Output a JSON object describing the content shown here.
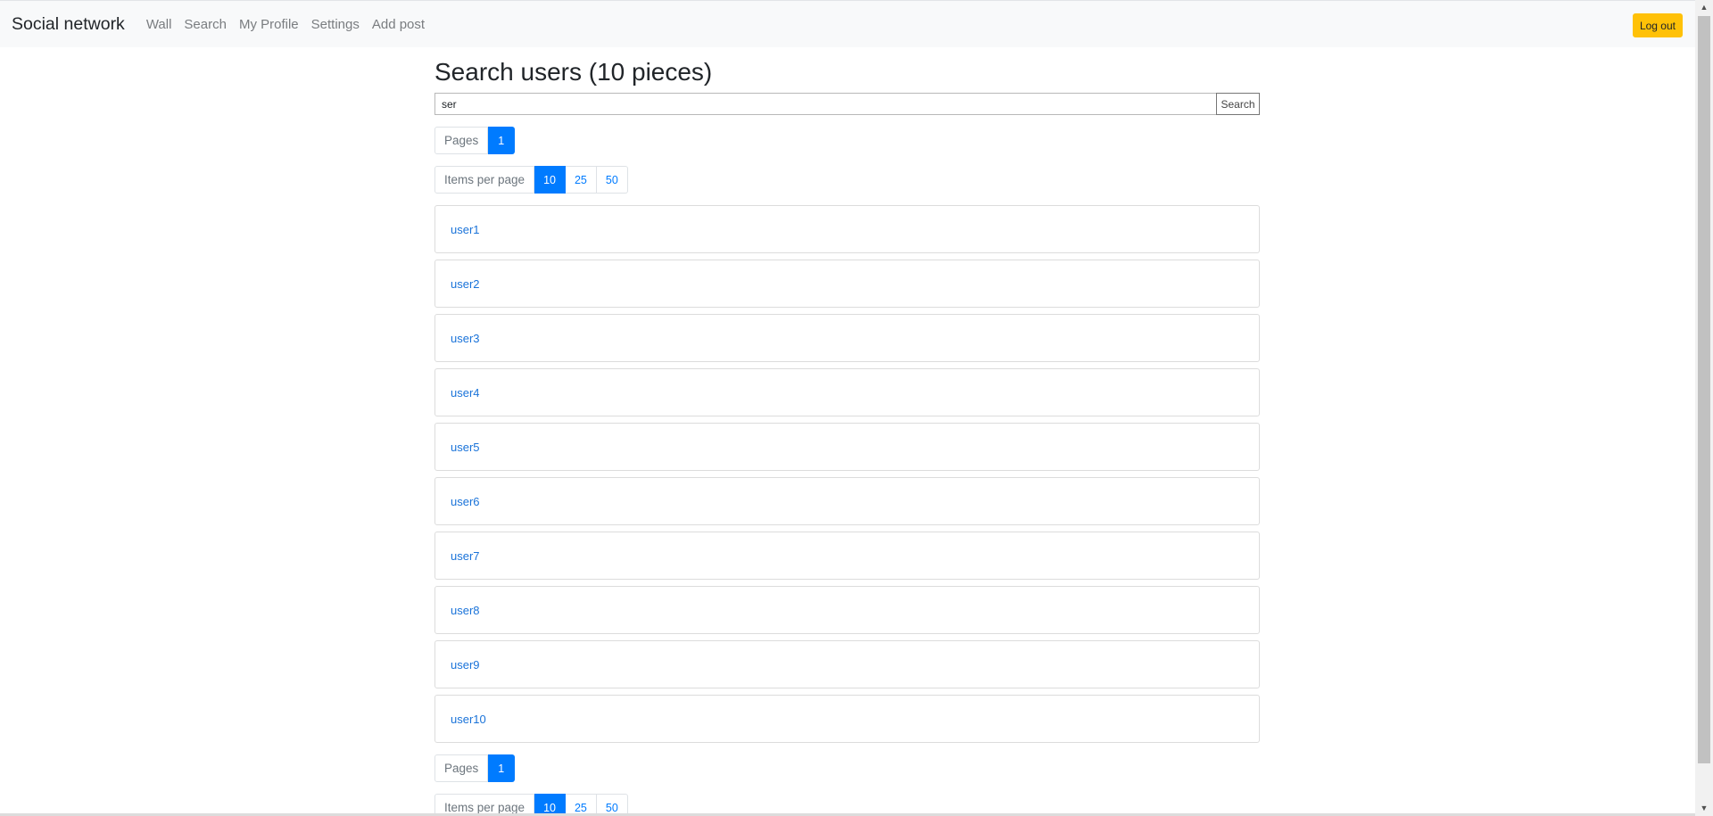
{
  "navbar": {
    "brand": "Social network",
    "links": [
      "Wall",
      "Search",
      "My Profile",
      "Settings",
      "Add post"
    ],
    "logout": "Log out"
  },
  "main": {
    "title": "Search users (10 pieces)",
    "search": {
      "value": "ser",
      "button": "Search"
    },
    "pages": {
      "label": "Pages",
      "items": [
        "1"
      ],
      "active": "1"
    },
    "per_page": {
      "label": "Items per page",
      "options": [
        "10",
        "25",
        "50"
      ],
      "active": "10"
    },
    "users": [
      "user1",
      "user2",
      "user3",
      "user4",
      "user5",
      "user6",
      "user7",
      "user8",
      "user9",
      "user10"
    ]
  },
  "colors": {
    "primary": "#007bff",
    "warning": "#ffc107",
    "navbar_bg": "#f8f9fa"
  }
}
